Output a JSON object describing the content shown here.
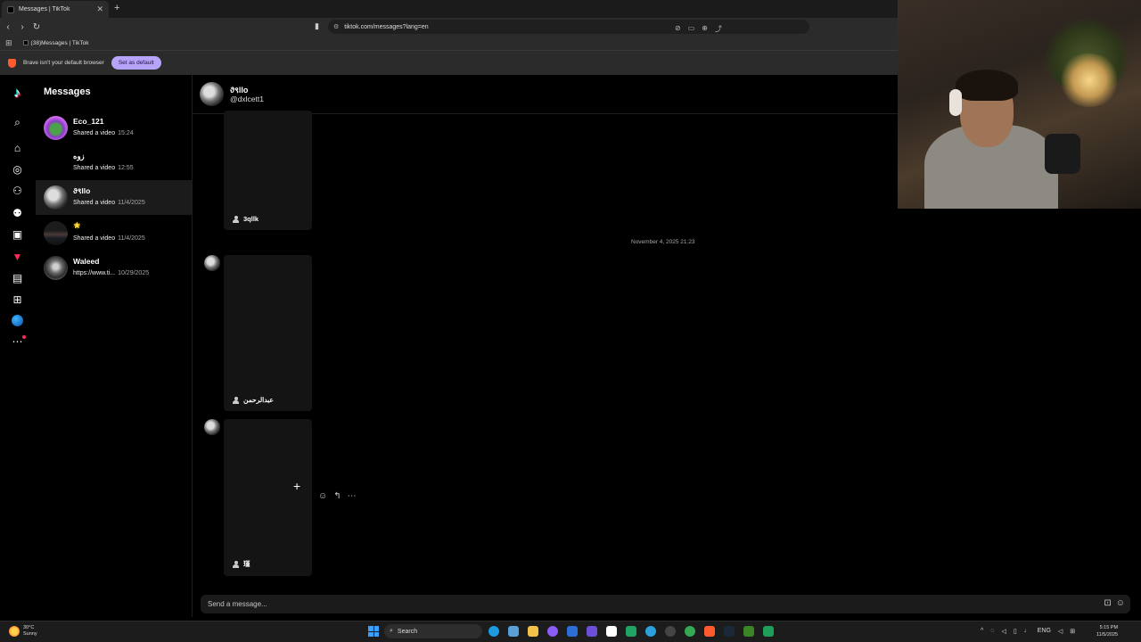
{
  "browser": {
    "tab_title": "Messages | TikTok",
    "new_tab_glyph": "+",
    "url": "tiktok.com/messages?lang=en",
    "bookmark_item": "(38)Messages | TikTok",
    "infobar_text": "Brave isn't your default browser",
    "set_default_label": "Set as default"
  },
  "sidebar": {
    "heading": "Messages",
    "conversations": [
      {
        "name": "Eco_121",
        "preview": "Shared a video",
        "time": "15:24"
      },
      {
        "name": "زوه",
        "preview": "Shared a video",
        "time": "12:55"
      },
      {
        "name": "ϑ९llo",
        "preview": "Shared a video",
        "time": "11/4/2025"
      },
      {
        "name": "🌟",
        "preview": "Shared a video",
        "time": "11/4/2025"
      },
      {
        "name": "Waleed",
        "preview": "https://www.ti...",
        "time": "10/29/2025"
      }
    ]
  },
  "chat": {
    "name": "ϑ९llo",
    "handle": "@dxlcett1",
    "date_divider": "November 4, 2025 21:23",
    "videos": [
      {
        "author": "3qllk"
      },
      {
        "author": "عبدالرحمن"
      },
      {
        "author": "瑾"
      }
    ],
    "composer_placeholder": "Send a message..."
  },
  "taskbar": {
    "weather_temp": "30°C",
    "weather_desc": "Sunny",
    "search_label": "Search",
    "language": "ENG",
    "time": "5:15 PM",
    "date": "11/5/2025"
  }
}
